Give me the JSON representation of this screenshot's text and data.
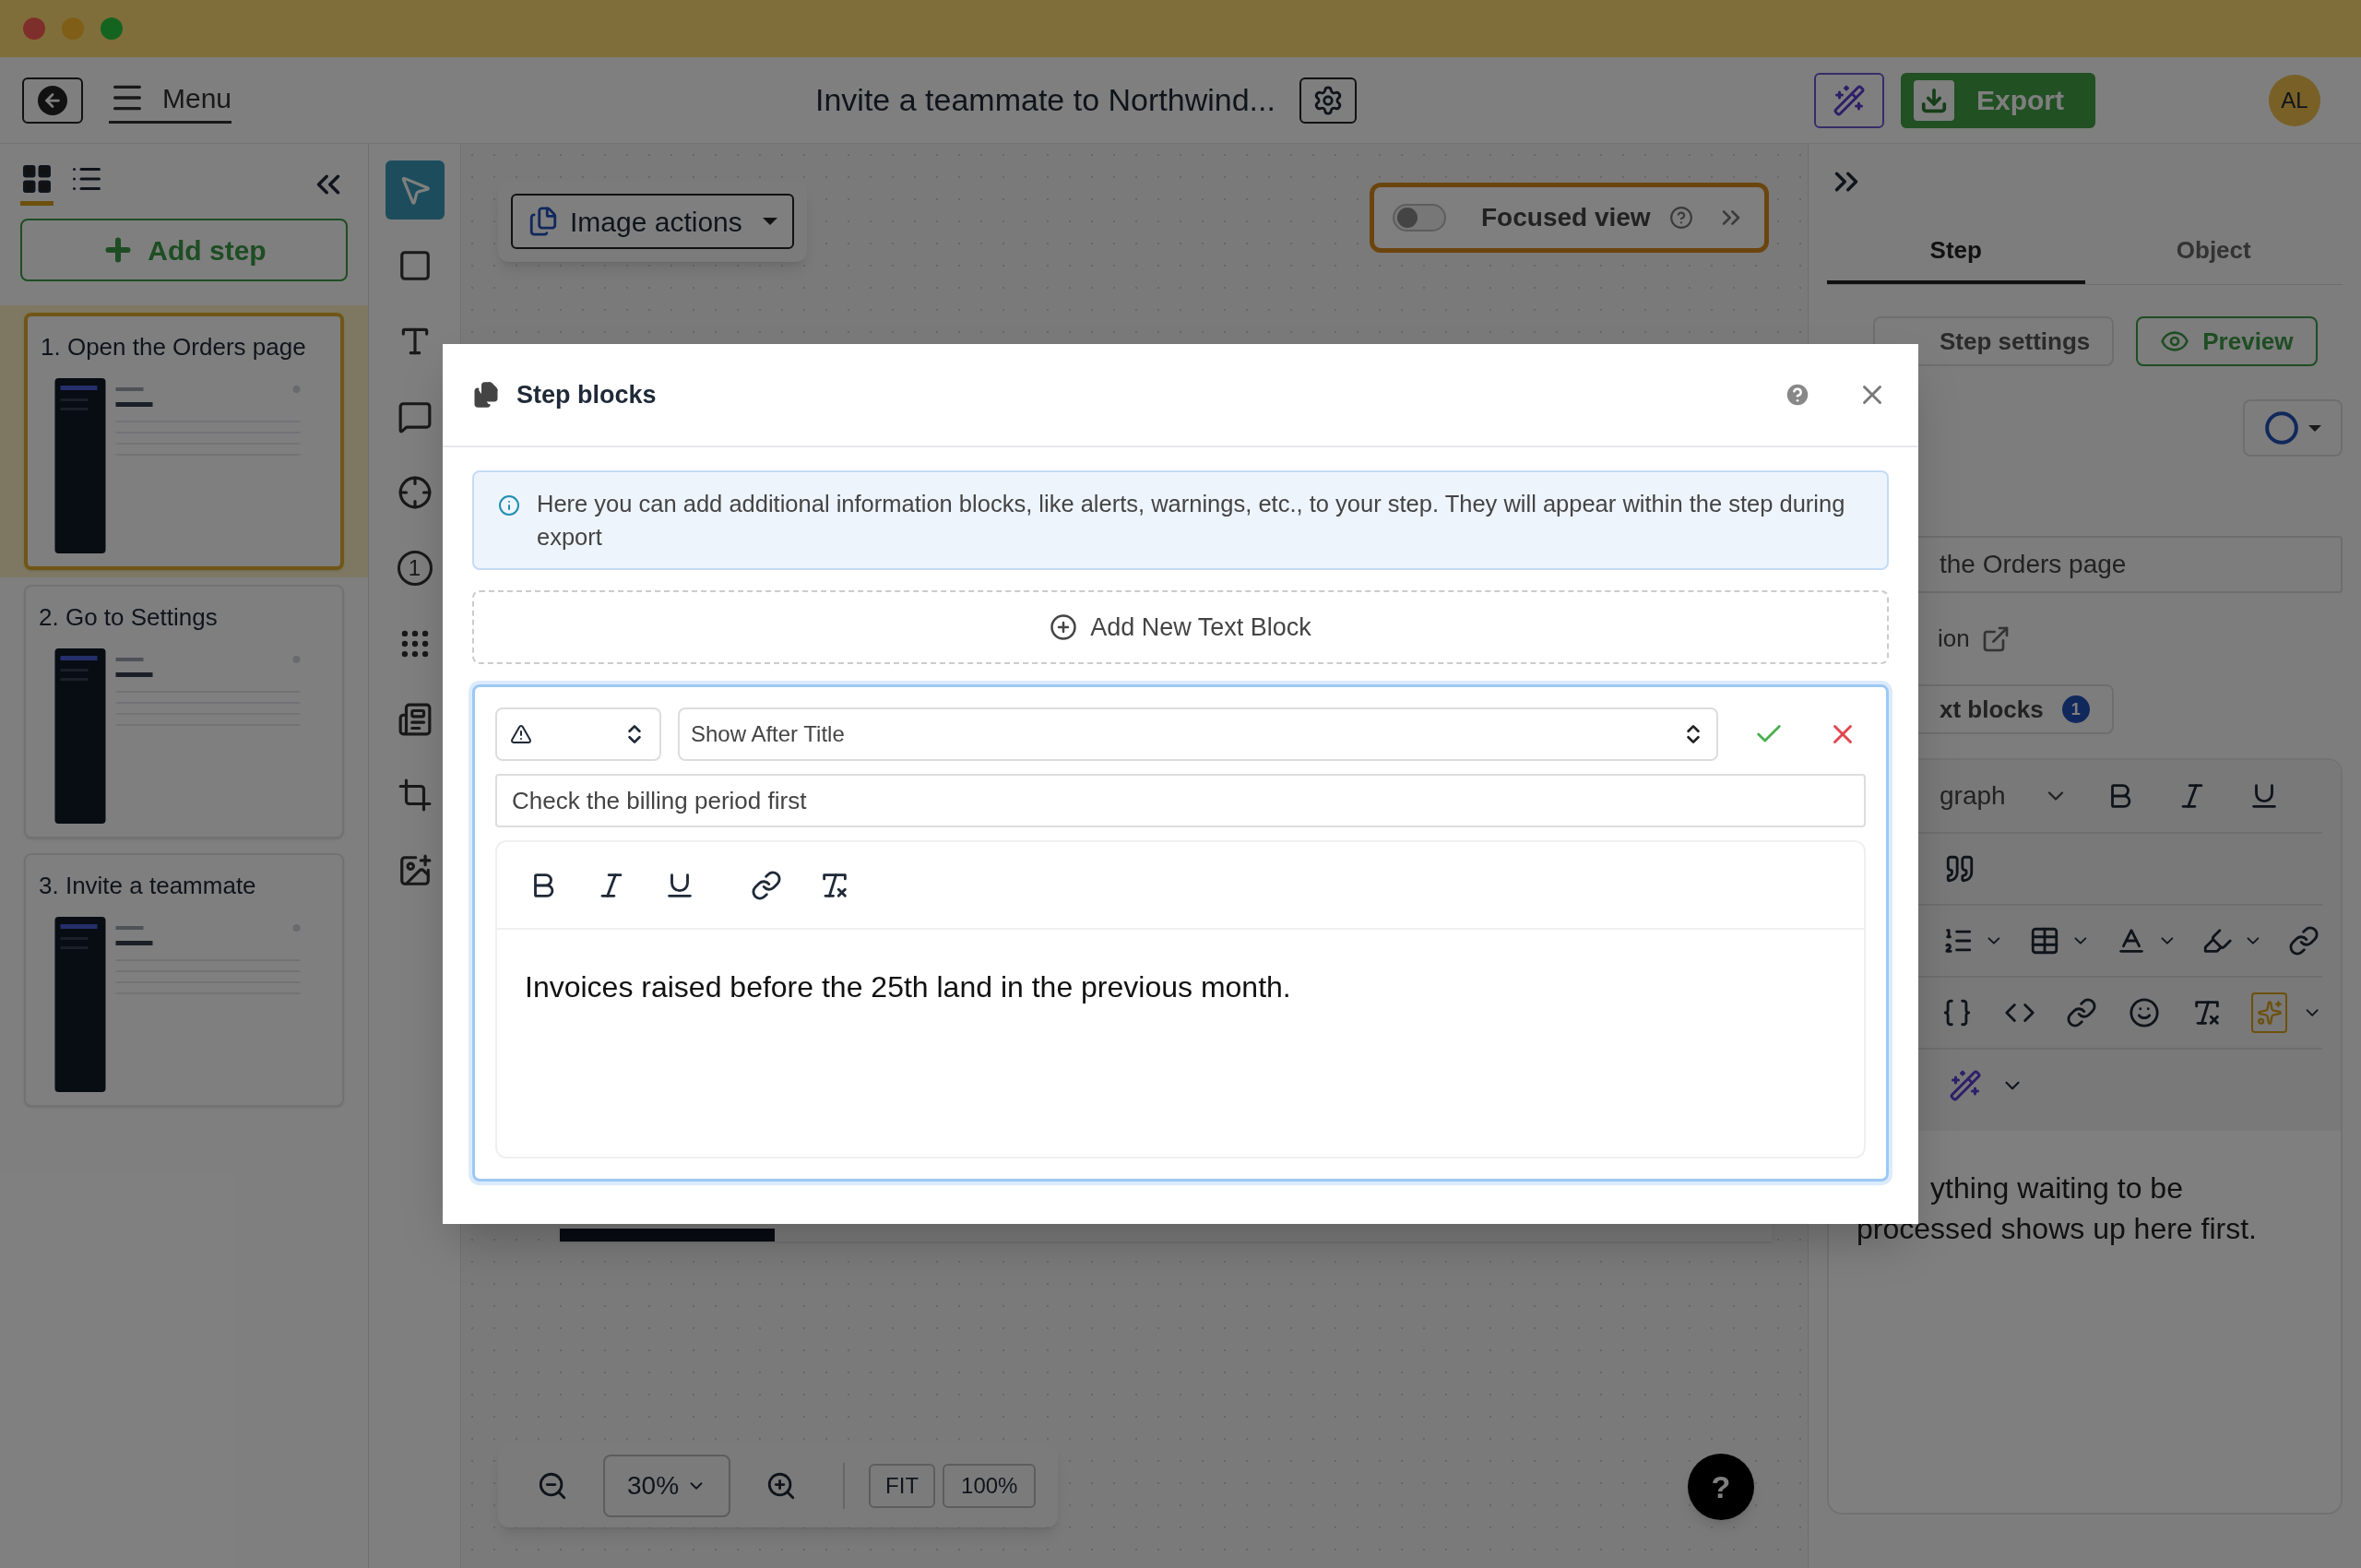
{
  "header": {
    "menu_label": "Menu",
    "title": "Invite a teammate to Northwind...",
    "export_label": "Export",
    "avatar": "AL"
  },
  "sidebar": {
    "views": [
      {
        "kind": "grid",
        "selected": true
      },
      {
        "kind": "list",
        "selected": false
      }
    ],
    "add_step": "Add step",
    "steps": [
      {
        "title": "1. Open the Orders page",
        "selected": true
      },
      {
        "title": "2. Go to Settings",
        "selected": false
      },
      {
        "title": "3. Invite a teammate",
        "selected": false
      }
    ]
  },
  "tools": [
    {
      "kind": "pointer",
      "selected": true
    },
    {
      "kind": "rectangle",
      "selected": false
    },
    {
      "kind": "text",
      "selected": false
    },
    {
      "kind": "comment",
      "selected": false
    },
    {
      "kind": "target",
      "selected": false
    },
    {
      "kind": "number",
      "label": "1",
      "selected": false
    },
    {
      "kind": "blur",
      "selected": false
    },
    {
      "kind": "image-text",
      "selected": false
    },
    {
      "kind": "crop",
      "selected": false
    },
    {
      "kind": "add-image",
      "selected": false
    }
  ],
  "canvas": {
    "image_actions": "Image actions",
    "focused_view": {
      "label": "Focused view",
      "on": false
    },
    "zoom": {
      "level_label": "30%",
      "fit": "FIT",
      "full": "100%"
    },
    "help": "?"
  },
  "right_panel": {
    "tabs": [
      {
        "label": "Step",
        "selected": true
      },
      {
        "label": "Object",
        "selected": false
      }
    ],
    "step_settings": "Step settings",
    "preview": "Preview",
    "title_value": "the Orders page",
    "description_label": "ion",
    "text_blocks_label": "xt blocks",
    "text_blocks_count": "1",
    "block_format": "graph",
    "body_lines": [
      "ything waiting to be",
      "processed shows up here first."
    ]
  },
  "modal": {
    "title": "Step blocks",
    "info": "Here you can add additional information blocks, like alerts, warnings, etc., to your step. They will appear within the step during export",
    "add_block": "Add New Text Block",
    "block": {
      "kind": "warning",
      "position": "Show After Title",
      "title_value": "Check the billing period first",
      "body": "Invoices raised before the 25th land in the previous month."
    }
  }
}
